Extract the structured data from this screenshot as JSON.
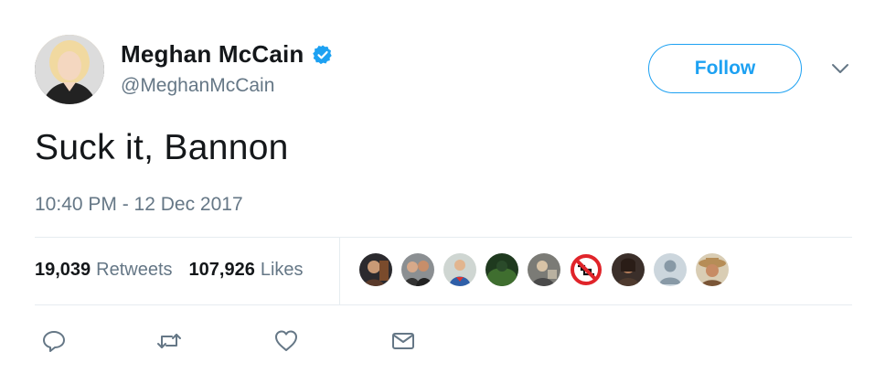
{
  "author": {
    "display_name": "Meghan McCain",
    "handle": "@MeghanMcCain",
    "verified": true,
    "avatar_icon": "profile-photo"
  },
  "follow_label": "Follow",
  "tweet": {
    "text": "Suck it, Bannon",
    "timestamp": "10:40 PM - 12 Dec 2017"
  },
  "stats": {
    "retweets_count": "19,039",
    "retweets_label": "Retweets",
    "likes_count": "107,926",
    "likes_label": "Likes"
  },
  "likers": [
    {
      "icon": "liker-avatar-1"
    },
    {
      "icon": "liker-avatar-2"
    },
    {
      "icon": "liker-avatar-3"
    },
    {
      "icon": "liker-avatar-4"
    },
    {
      "icon": "liker-avatar-5"
    },
    {
      "icon": "no-symbol-avatar"
    },
    {
      "icon": "liker-avatar-7"
    },
    {
      "icon": "default-avatar"
    },
    {
      "icon": "liker-avatar-9"
    }
  ],
  "actions": [
    {
      "icon": "reply-icon"
    },
    {
      "icon": "retweet-icon"
    },
    {
      "icon": "like-heart-icon"
    },
    {
      "icon": "direct-message-icon"
    }
  ],
  "colors": {
    "accent": "#1da1f2",
    "text": "#14171a",
    "secondary_text": "#657786",
    "divider": "#e6ecf0"
  }
}
